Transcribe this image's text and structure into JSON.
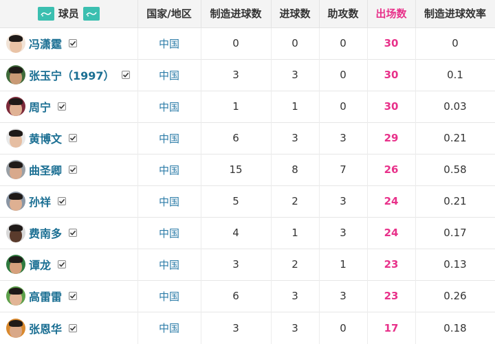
{
  "header": {
    "player": "球员",
    "country": "国家/地区",
    "key_passes": "制造进球数",
    "goals": "进球数",
    "assists": "助攻数",
    "appearances": "出场数",
    "efficiency": "制造进球效率"
  },
  "colors": {
    "accent_pink": "#e8318a",
    "player_link": "#1b6f93",
    "country_link": "#2c7ca8",
    "logo_teal": "#3bbfb0"
  },
  "rows": [
    {
      "name": "冯潇霆",
      "country": "中国",
      "created": "0",
      "goals": "0",
      "assists": "0",
      "apps": "30",
      "eff": "0",
      "skin": "#e9c3a6",
      "bg": "#f1e3d6"
    },
    {
      "name": "张玉宁（1997）",
      "country": "中国",
      "created": "3",
      "goals": "3",
      "assists": "0",
      "apps": "30",
      "eff": "0.1",
      "skin": "#c99a76",
      "bg": "#3f6b3a"
    },
    {
      "name": "周宁",
      "country": "中国",
      "created": "1",
      "goals": "1",
      "assists": "0",
      "apps": "30",
      "eff": "0.03",
      "skin": "#e0b294",
      "bg": "#7d2a3a"
    },
    {
      "name": "黄博文",
      "country": "中国",
      "created": "6",
      "goals": "3",
      "assists": "3",
      "apps": "29",
      "eff": "0.21",
      "skin": "#e6bea2",
      "bg": "#e8e8e8"
    },
    {
      "name": "曲圣卿",
      "country": "中国",
      "created": "15",
      "goals": "8",
      "assists": "7",
      "apps": "26",
      "eff": "0.58",
      "skin": "#d8a98c",
      "bg": "#9aa0a6"
    },
    {
      "name": "孙祥",
      "country": "中国",
      "created": "5",
      "goals": "2",
      "assists": "3",
      "apps": "24",
      "eff": "0.21",
      "skin": "#deb092",
      "bg": "#8a96a4"
    },
    {
      "name": "费南多",
      "country": "中国",
      "created": "4",
      "goals": "1",
      "assists": "3",
      "apps": "24",
      "eff": "0.17",
      "skin": "#5a3b2c",
      "bg": "#d8d8d8"
    },
    {
      "name": "谭龙",
      "country": "中国",
      "created": "3",
      "goals": "2",
      "assists": "1",
      "apps": "23",
      "eff": "0.13",
      "skin": "#d6a07c",
      "bg": "#2f7a3f"
    },
    {
      "name": "高雷雷",
      "country": "中国",
      "created": "6",
      "goals": "3",
      "assists": "3",
      "apps": "23",
      "eff": "0.26",
      "skin": "#e2b596",
      "bg": "#5da04a"
    },
    {
      "name": "张恩华",
      "country": "中国",
      "created": "3",
      "goals": "3",
      "assists": "0",
      "apps": "17",
      "eff": "0.18",
      "skin": "#d9a888",
      "bg": "#d9892e"
    }
  ]
}
